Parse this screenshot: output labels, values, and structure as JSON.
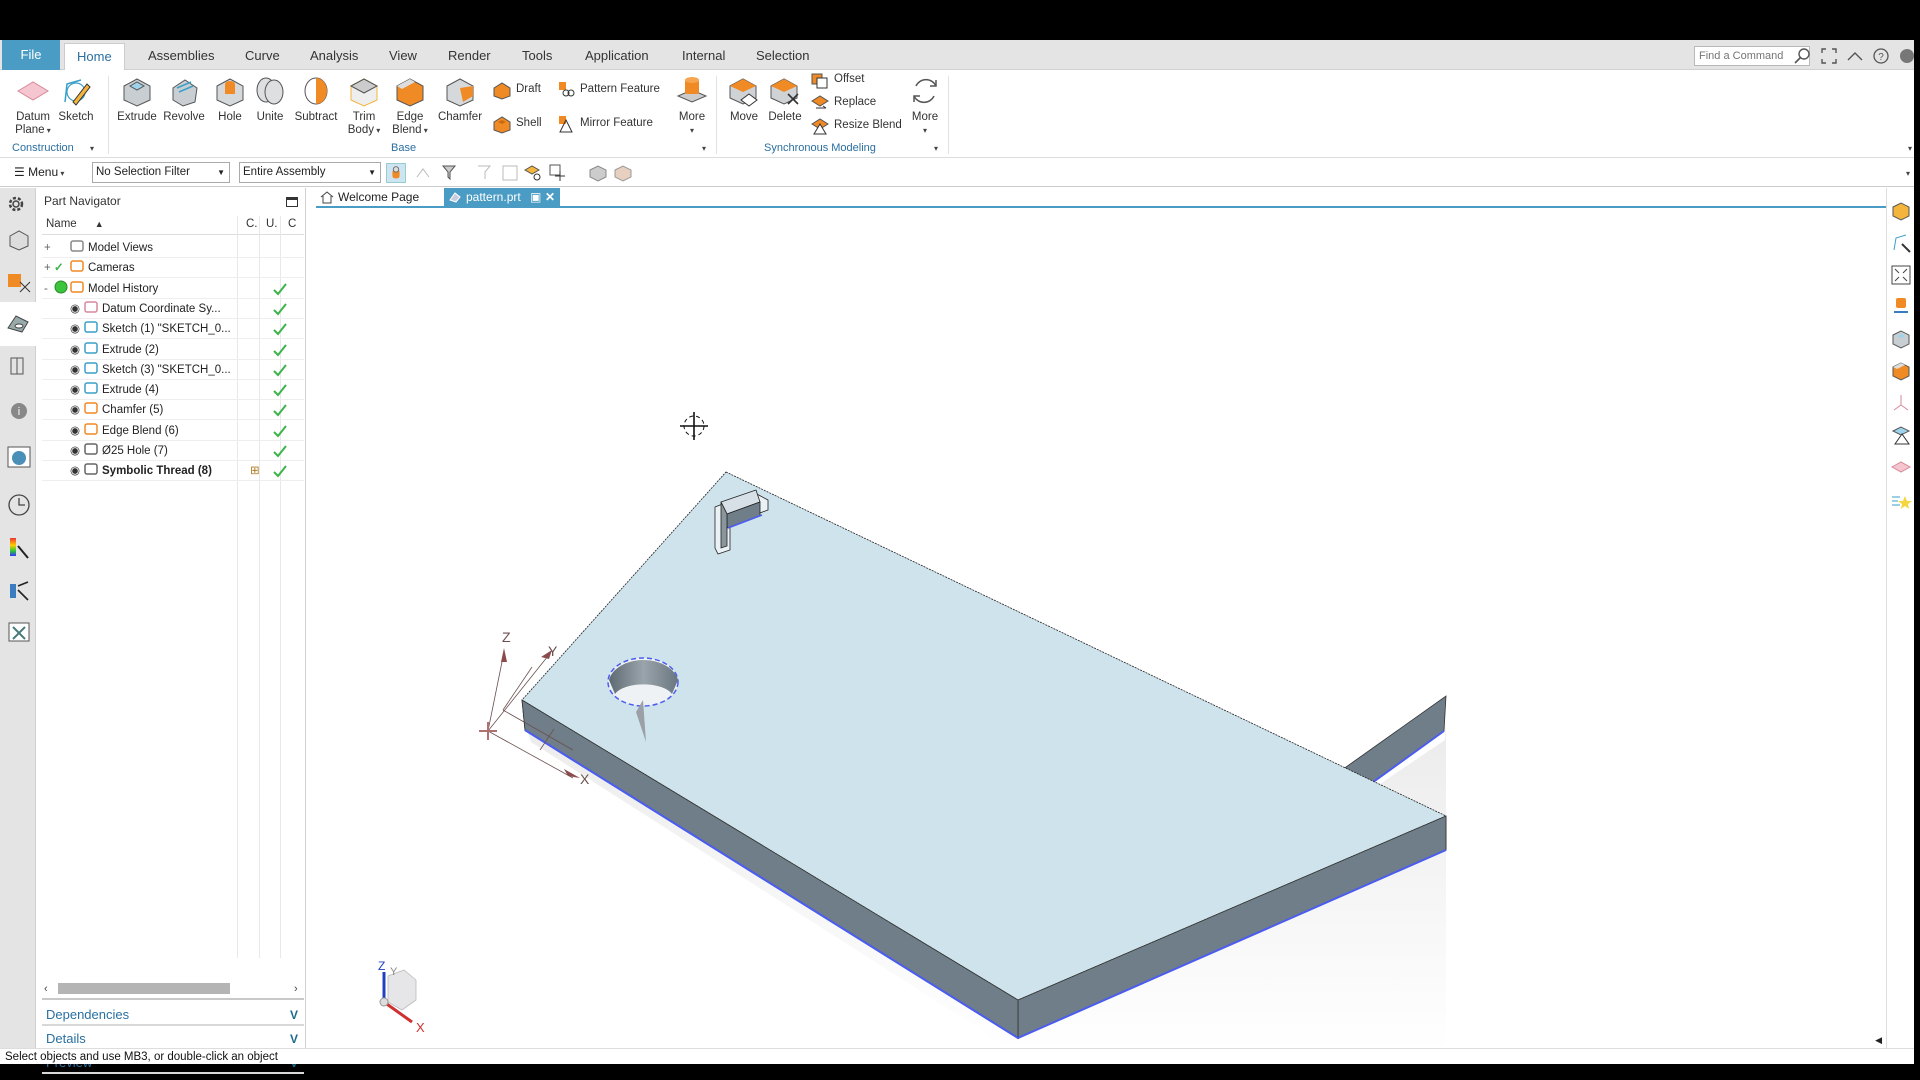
{
  "menubar": {
    "tabs": [
      "File",
      "Home",
      "Assemblies",
      "Curve",
      "Analysis",
      "View",
      "Render",
      "Tools",
      "Application",
      "Internal",
      "Selection"
    ],
    "active_tab": "Home",
    "find_command_placeholder": "Find a Command"
  },
  "ribbon": {
    "construction": {
      "group_label": "Construction",
      "datum_plane": "Datum",
      "datum_plane2": "Plane",
      "sketch": "Sketch"
    },
    "base": {
      "group_label": "Base",
      "extrude": "Extrude",
      "revolve": "Revolve",
      "hole": "Hole",
      "unite": "Unite",
      "subtract": "Subtract",
      "trim_body": "Trim",
      "trim_body2": "Body",
      "edge_blend": "Edge",
      "edge_blend2": "Blend",
      "chamfer": "Chamfer",
      "draft": "Draft",
      "shell": "Shell",
      "pattern_feature": "Pattern Feature",
      "mirror_feature": "Mirror Feature",
      "more": "More"
    },
    "sync": {
      "group_label": "Synchronous Modeling",
      "move": "Move",
      "delete": "Delete",
      "offset": "Offset",
      "replace": "Replace",
      "resize_blend": "Resize Blend",
      "more": "More"
    }
  },
  "toolbar": {
    "menu_label": "Menu",
    "selection_filter": "No Selection Filter",
    "scope": "Entire Assembly"
  },
  "navigator": {
    "title": "Part Navigator",
    "columns": [
      "Name",
      "C.",
      "U.",
      "C"
    ],
    "rows": [
      {
        "label": "Model Views",
        "level": 0,
        "expander": "+",
        "check": false,
        "bold": false
      },
      {
        "label": "Cameras",
        "level": 0,
        "expander": "+",
        "check": false,
        "bold": false
      },
      {
        "label": "Model History",
        "level": 0,
        "expander": "-",
        "check": true,
        "bold": false
      },
      {
        "label": "Datum Coordinate Sy...",
        "level": 1,
        "check": true,
        "bold": false
      },
      {
        "label": "Sketch (1) \"SKETCH_0...",
        "level": 1,
        "check": true,
        "bold": false
      },
      {
        "label": "Extrude (2)",
        "level": 1,
        "check": true,
        "bold": false
      },
      {
        "label": "Sketch (3) \"SKETCH_0...",
        "level": 1,
        "check": true,
        "bold": false
      },
      {
        "label": "Extrude (4)",
        "level": 1,
        "check": true,
        "bold": false
      },
      {
        "label": "Chamfer (5)",
        "level": 1,
        "check": true,
        "bold": false
      },
      {
        "label": "Edge Blend (6)",
        "level": 1,
        "check": true,
        "bold": false
      },
      {
        "label": "Ø25 Hole (7)",
        "level": 1,
        "check": true,
        "bold": false
      },
      {
        "label": "Symbolic Thread (8)",
        "level": 1,
        "check": true,
        "bold": true
      }
    ],
    "panels": [
      "Dependencies",
      "Details",
      "Preview"
    ]
  },
  "doc_tabs": [
    {
      "label": "Welcome Page",
      "active": false
    },
    {
      "label": "pattern.prt",
      "active": true
    }
  ],
  "viewport": {
    "csys_labels": {
      "x": "X",
      "y": "Y",
      "z": "Z"
    },
    "triad_labels": {
      "x": "X",
      "y": "Y",
      "z": "Z"
    }
  },
  "colors": {
    "accent": "#4a9cc4",
    "part_top": "#cfe3ec",
    "part_side": "#6f7e88",
    "edge_highlight": "#4b5cf0",
    "check_green": "#3cb34a",
    "icon_orange": "#f08a24"
  },
  "status": {
    "message": "Select objects and use MB3, or double-click an object"
  }
}
